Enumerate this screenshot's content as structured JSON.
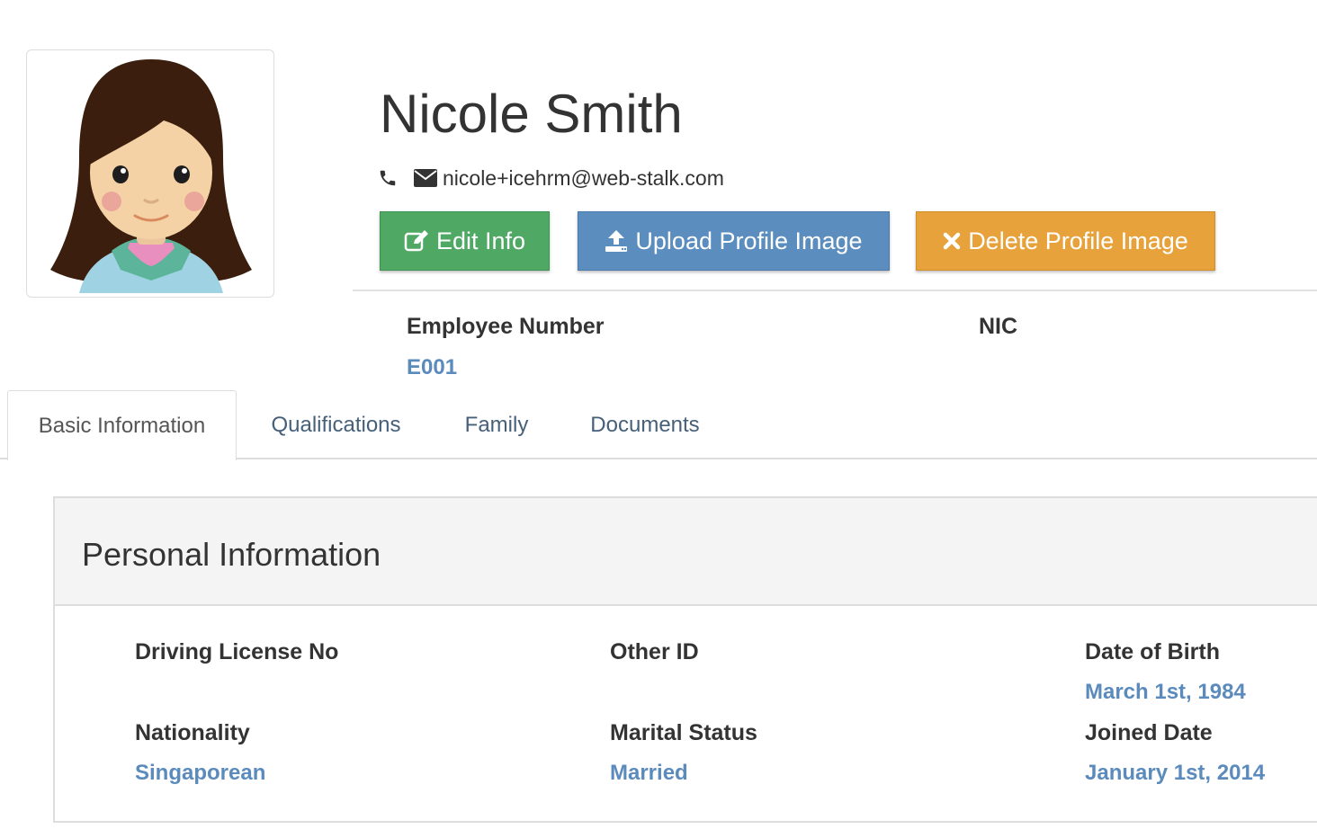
{
  "profile": {
    "name": "Nicole Smith",
    "email": "nicole+icehrm@web-stalk.com",
    "avatar_icon": "female-avatar-illustration"
  },
  "actions": {
    "edit_label": "Edit Info",
    "upload_label": "Upload Profile Image",
    "delete_label": "Delete Profile Image"
  },
  "summary": {
    "employee_number_label": "Employee Number",
    "employee_number_value": "E001",
    "nic_label": "NIC",
    "nic_value": ""
  },
  "tabs": [
    {
      "label": "Basic Information",
      "active": true
    },
    {
      "label": "Qualifications",
      "active": false
    },
    {
      "label": "Family",
      "active": false
    },
    {
      "label": "Documents",
      "active": false
    }
  ],
  "personal": {
    "title": "Personal Information",
    "fields": [
      {
        "label": "Driving License No",
        "value": ""
      },
      {
        "label": "Other ID",
        "value": ""
      },
      {
        "label": "Date of Birth",
        "value": "March 1st, 1984"
      },
      {
        "label": "Nationality",
        "value": "Singaporean"
      },
      {
        "label": "Marital Status",
        "value": "Married"
      },
      {
        "label": "Joined Date",
        "value": "January 1st, 2014"
      }
    ]
  },
  "colors": {
    "edit": "#4fa965",
    "upload": "#5b8dbf",
    "delete": "#e7a23c",
    "value_link": "#5b8bbd"
  }
}
